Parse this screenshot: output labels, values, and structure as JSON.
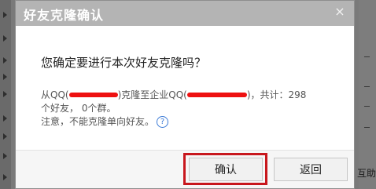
{
  "dialog": {
    "title": "好友克隆确认",
    "close_glyph": "×",
    "question": "您确定要进行本次好友克隆吗？",
    "info_line1_prefix": "从QQ(",
    "info_line1_mid": ")克隆至企业QQ(",
    "info_line1_suffix": ")，共计：298",
    "info_line2": "个好友， 0个群。",
    "info_line3": "注意，不能克隆单向好友。",
    "help_glyph": "?",
    "help_icon": "question-circle-icon",
    "confirm_label": "确认",
    "back_label": "返回",
    "highlight_color": "#c8171d",
    "redaction_color": "#ee1111"
  },
  "background": {
    "right_text": "互助"
  }
}
